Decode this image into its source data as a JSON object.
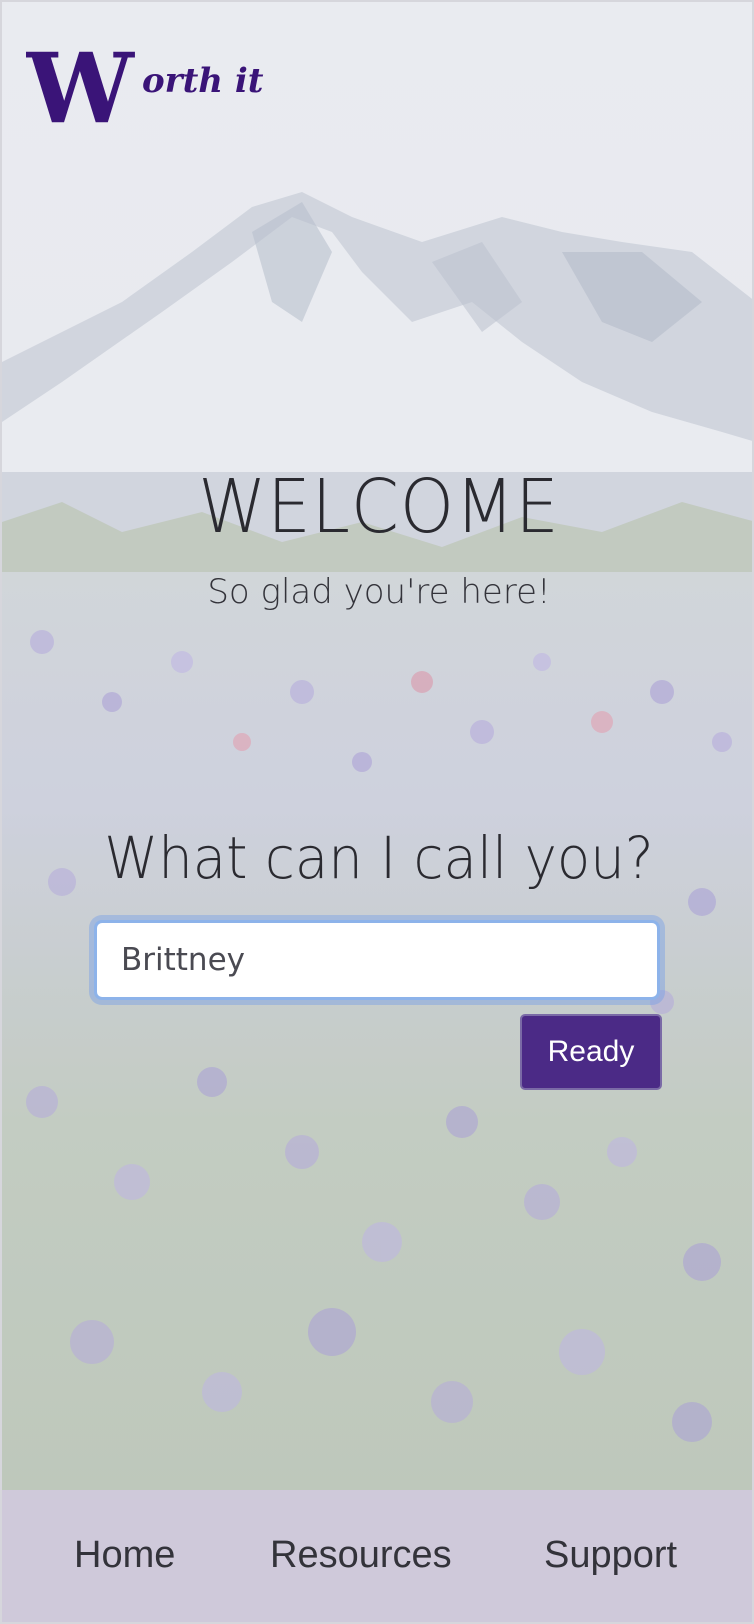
{
  "brand": {
    "logo_letter": "W",
    "logo_text": "orth it",
    "logo_color": "#3a1478"
  },
  "welcome": {
    "title": "WELCOME",
    "subtitle": "So glad you're here!"
  },
  "prompt": {
    "question": "What can I call you?",
    "name_value": "Brittney",
    "ready_label": "Ready"
  },
  "nav": {
    "items": [
      {
        "label": "Home"
      },
      {
        "label": "Resources"
      },
      {
        "label": "Support"
      }
    ]
  },
  "colors": {
    "accent": "#4b2a86",
    "nav_background": "#cfc9da",
    "input_focus": "#8db3ea"
  }
}
